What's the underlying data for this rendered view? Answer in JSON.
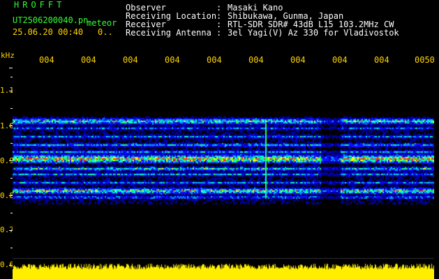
{
  "header": {
    "app_name": "HROFFT",
    "file_name": "UT2506200040.pn",
    "event_label": "meteor",
    "datetime": "25.06.20 00:40",
    "count": "0.."
  },
  "station": [
    {
      "label": "Observer",
      "sep": ":",
      "value": "Masaki Kano"
    },
    {
      "label": "Receiving Location",
      "sep": ":",
      "value": "Shibukawa, Gunma, Japan"
    },
    {
      "label": "Receiver",
      "sep": ":",
      "value": "RTL-SDR SDR# 43dB L15 103.2MHz CW"
    },
    {
      "label": "Receiving Antenna",
      "sep": ":",
      "value": "3el Yagi(V) Az 330 for Vladivostok"
    }
  ],
  "y_axis": {
    "unit": "kHz",
    "ticks": [
      "1.1",
      "1.0",
      "0.9",
      "0.8",
      "0.7",
      "0.6"
    ]
  },
  "x_axis": {
    "ticks": [
      "004",
      "004",
      "004",
      "004",
      "004",
      "004",
      "004",
      "004",
      "004",
      "0050"
    ]
  },
  "colors": {
    "header_green": "#33ff33",
    "label_yellow": "#ffd400",
    "text_white": "#ffffff",
    "background": "#000000",
    "signal_bar": "#ffee00"
  }
}
